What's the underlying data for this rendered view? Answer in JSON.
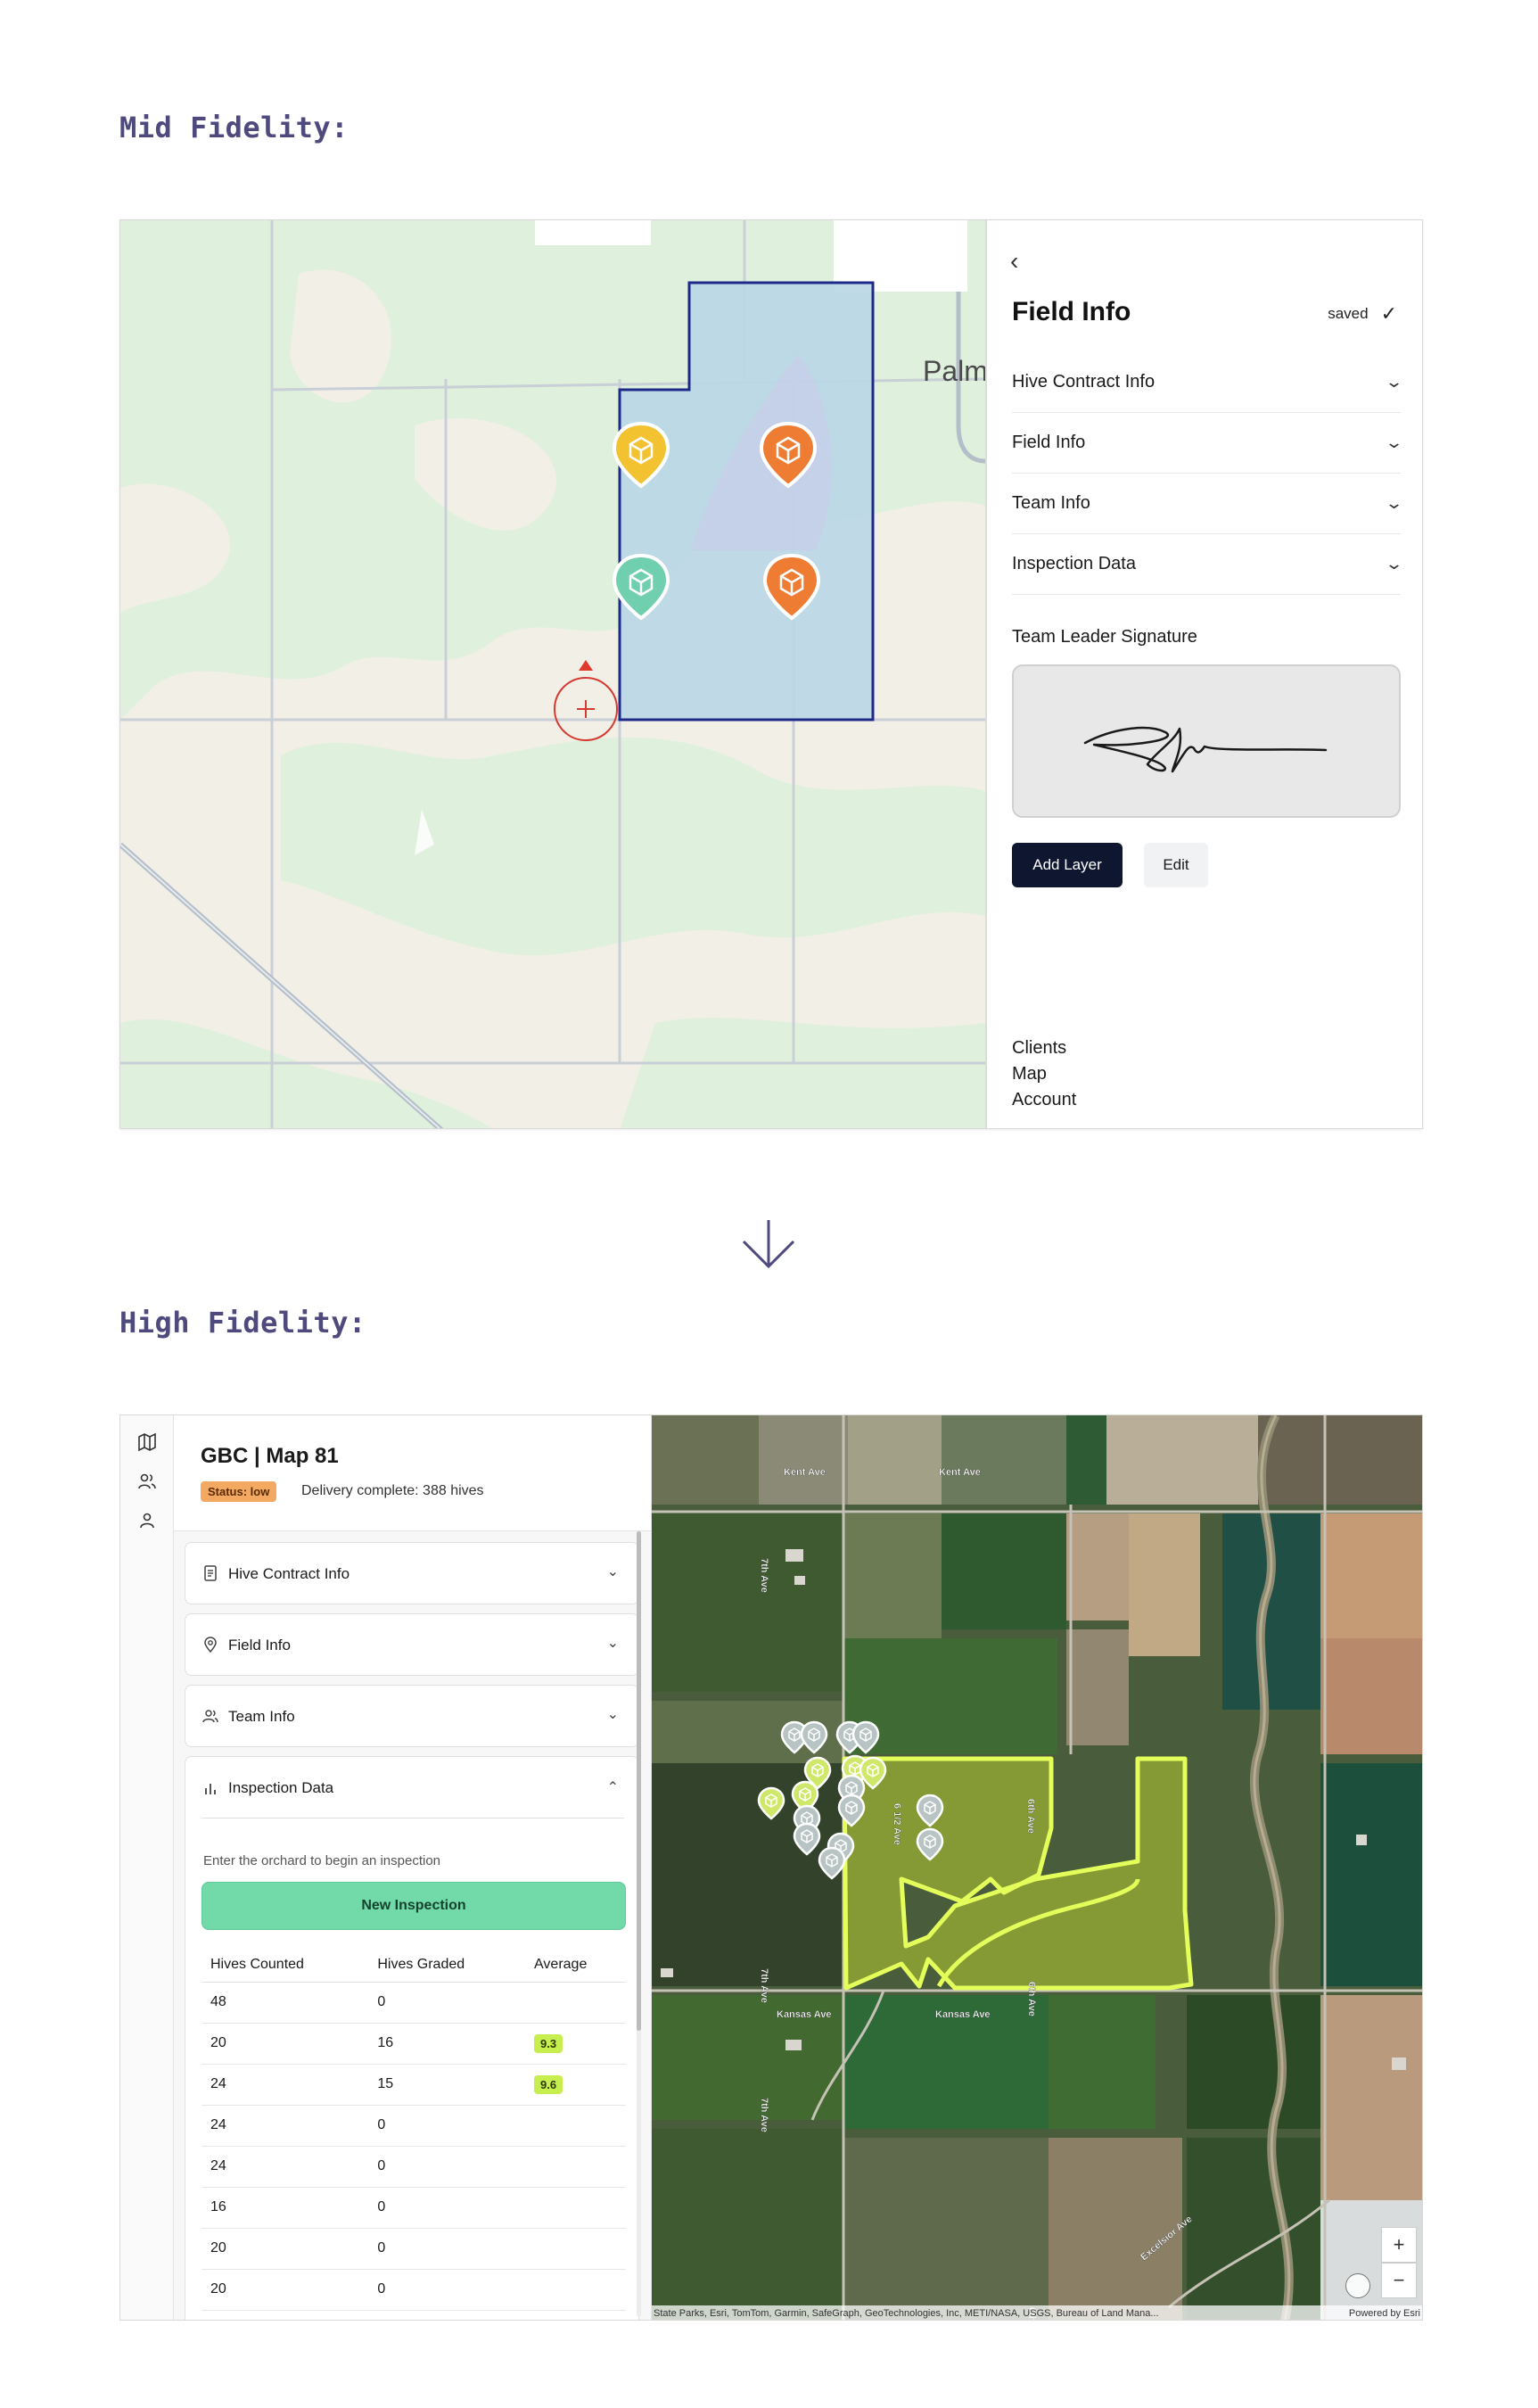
{
  "sections": {
    "mid_title": "Mid Fidelity:",
    "high_title": "High Fidelity:"
  },
  "mid": {
    "map": {
      "city_label": "Palm"
    },
    "panel": {
      "back_icon": "chevron-left-icon",
      "title": "Field Info",
      "saved_text": "saved",
      "accordions": [
        "Hive Contract Info",
        "Field Info",
        "Team Info",
        "Inspection Data"
      ],
      "signature_label": "Team Leader Signature",
      "add_layer_label": "Add Layer",
      "edit_label": "Edit",
      "nav": [
        "Clients",
        "Map",
        "Account"
      ]
    }
  },
  "high": {
    "rail_icons": [
      "map-icon",
      "users-icon",
      "user-icon"
    ],
    "title": "GBC | Map 81",
    "status_badge": "Status: low",
    "delivery_text": "Delivery complete: 388 hives",
    "accordions": [
      {
        "label": "Hive Contract Info",
        "icon": "document-icon"
      },
      {
        "label": "Field Info",
        "icon": "location-pin-icon"
      },
      {
        "label": "Team Info",
        "icon": "users-icon"
      }
    ],
    "inspection": {
      "label": "Inspection Data",
      "icon": "bar-chart-icon",
      "hint": "Enter the orchard to begin an inspection",
      "button_label": "New Inspection",
      "columns": [
        "Hives Counted",
        "Hives Graded",
        "Average"
      ],
      "rows": [
        [
          "48",
          "0",
          ""
        ],
        [
          "20",
          "16",
          "9.3"
        ],
        [
          "24",
          "15",
          "9.6"
        ],
        [
          "24",
          "0",
          ""
        ],
        [
          "24",
          "0",
          ""
        ],
        [
          "16",
          "0",
          ""
        ],
        [
          "20",
          "0",
          ""
        ],
        [
          "20",
          "0",
          ""
        ]
      ]
    },
    "map": {
      "road_labels": [
        "Kent Ave",
        "Kent Ave",
        "Kansas Ave",
        "Kansas Ave",
        "7th Ave",
        "7th Ave",
        "7th Ave",
        "6 1/2 Ave",
        "6th Ave",
        "6th Ave",
        "6th Ave",
        "Excelsior Ave"
      ],
      "zoom_in": "+",
      "zoom_out": "−",
      "attribution": "State Parks, Esri, TomTom, Garmin, SafeGraph, GeoTechnologies, Inc, METI/NASA, USGS, Bureau of Land Mana...",
      "powered_by": "Powered by Esri"
    }
  },
  "colors": {
    "section_title": "#4f4a7e",
    "primary_button": "#0f1730",
    "inspection_button": "#72d9a8",
    "status_low": "#f3a962",
    "average_badge": "#c7ee4f",
    "field_outline": "#e4ff5a",
    "mid_polygon_stroke": "#1e2a8a",
    "marker_yellow": "#f2c230",
    "marker_orange": "#ee7d33",
    "marker_teal": "#6fcfae",
    "hive_marker_grey": "#b8c3c3",
    "hive_marker_green": "#cfe86a"
  }
}
